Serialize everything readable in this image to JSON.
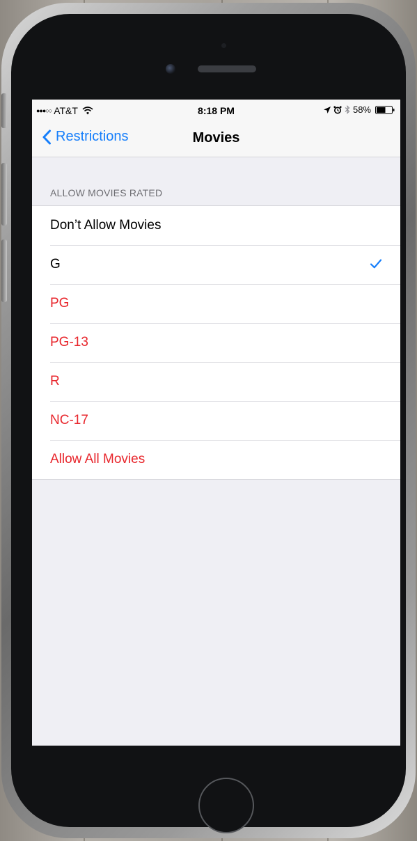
{
  "status_bar": {
    "carrier": "AT&T",
    "time": "8:18 PM",
    "battery": "58%",
    "icons": [
      "signal-dots-icon",
      "wifi-icon",
      "location-arrow-icon",
      "alarm-icon",
      "bluetooth-icon",
      "battery-icon"
    ]
  },
  "nav": {
    "back_label": "Restrictions",
    "title": "Movies"
  },
  "section": {
    "header": "ALLOW MOVIES RATED"
  },
  "options": [
    {
      "label": "Don’t Allow Movies",
      "selected": false,
      "restricted": false
    },
    {
      "label": "G",
      "selected": true,
      "restricted": false
    },
    {
      "label": "PG",
      "selected": false,
      "restricted": true
    },
    {
      "label": "PG-13",
      "selected": false,
      "restricted": true
    },
    {
      "label": "R",
      "selected": false,
      "restricted": true
    },
    {
      "label": "NC-17",
      "selected": false,
      "restricted": true
    },
    {
      "label": "Allow All Movies",
      "selected": false,
      "restricted": true
    }
  ],
  "colors": {
    "accent": "#157efb",
    "restricted": "#e8262c",
    "background": "#efeff4",
    "section_header": "#6d6d72"
  }
}
